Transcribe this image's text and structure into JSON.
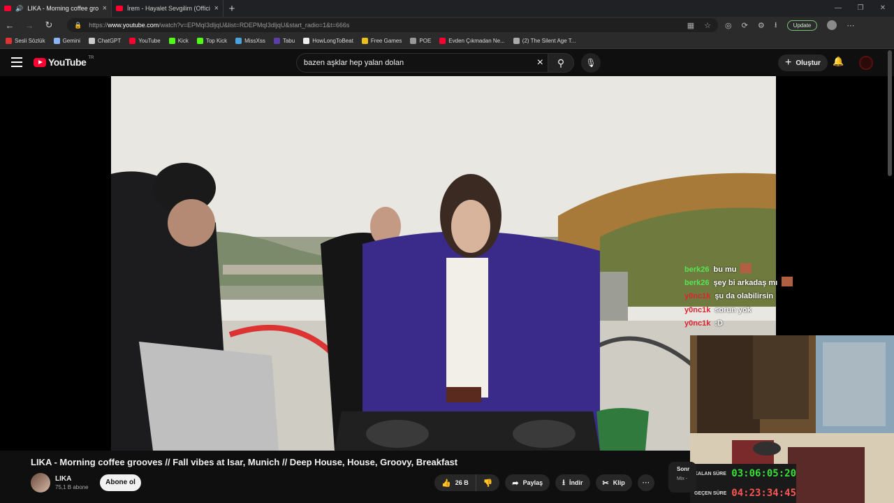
{
  "browser": {
    "tabs": [
      {
        "title": "LIKA - Morning coffee grooves",
        "active": true
      },
      {
        "title": "İrem - Hayalet Sevgilim (Official A",
        "active": false
      }
    ],
    "new_tab": "+",
    "url_prefix": "https://",
    "url_host": "www.youtube.com",
    "url_path": "/watch?v=EPMqI3dljqU&list=RDEPMqI3dljqU&start_radio=1&t=666s",
    "update_label": "Update"
  },
  "bookmarks": [
    {
      "label": "Sesli Sözlük",
      "icon": "flag-icon",
      "color": "#d33"
    },
    {
      "label": "Gemini",
      "icon": "gemini-icon",
      "color": "#8ab4f8"
    },
    {
      "label": "ChatGPT",
      "icon": "chatgpt-icon",
      "color": "#ccc"
    },
    {
      "label": "YouTube",
      "icon": "youtube-icon",
      "color": "#ff0033"
    },
    {
      "label": "Kick",
      "icon": "kick-icon",
      "color": "#53fc18"
    },
    {
      "label": "Top Kick",
      "icon": "kick-icon",
      "color": "#53fc18"
    },
    {
      "label": "MissXss",
      "icon": "missxss-icon",
      "color": "#4aa3df"
    },
    {
      "label": "Tabu",
      "icon": "tabu-icon",
      "color": "#5b3ea8"
    },
    {
      "label": "HowLongToBeat",
      "icon": "hltb-icon",
      "color": "#eee"
    },
    {
      "label": "Free Games",
      "icon": "tag-icon",
      "color": "#e8c020"
    },
    {
      "label": "POE",
      "icon": "folder-icon",
      "color": "#999"
    },
    {
      "label": "Evden Çıkmadan Ne...",
      "icon": "youtube-icon",
      "color": "#ff0033"
    },
    {
      "label": "(2) The Silent Age T...",
      "icon": "globe-icon",
      "color": "#aaa"
    }
  ],
  "youtube": {
    "logo_text": "YouTube",
    "logo_region": "TR",
    "search_value": "bazen aşklar hep yalan dolan",
    "create_label": "Oluştur"
  },
  "chat": [
    {
      "user": "berk26",
      "msg": "bu mu",
      "color": "#57e357",
      "emote": true
    },
    {
      "user": "berk26",
      "msg": "şey bi arkadaş mı",
      "color": "#57e357",
      "emote": true
    },
    {
      "user": "y0nc1k",
      "msg": "şu da olabilirsin",
      "color": "#dd2233",
      "emote": false
    },
    {
      "user": "y0nc1k",
      "msg": "sorun yok",
      "color": "#dd2233",
      "emote": false
    },
    {
      "user": "y0nc1k",
      "msg": ":D",
      "color": "#dd2233",
      "emote": false
    }
  ],
  "timers": {
    "remaining_label": "KALAN SÜRE",
    "remaining_value": "03:06:05:20",
    "elapsed_label": "GEÇEN SÜRE",
    "elapsed_value": "04:23:34:45"
  },
  "video": {
    "title": "LIKA - Morning coffee grooves // Fall vibes at Isar, Munich // Deep House, House, Groovy, Breakfast",
    "channel": "LIKA",
    "subscribers": "75,1 B abone",
    "subscribe_label": "Abone ol",
    "likes": "26 B",
    "share_label": "Paylaş",
    "download_label": "İndir",
    "clip_label": "Klip",
    "upnext_title": "Sonr",
    "upnext_sub": "Mix -"
  }
}
